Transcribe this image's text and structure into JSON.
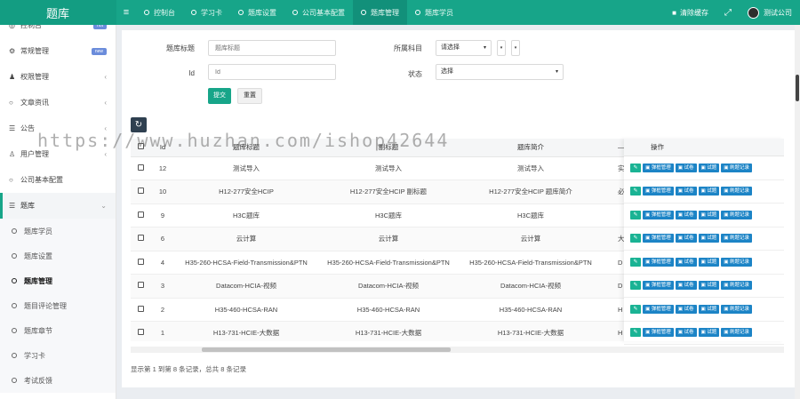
{
  "topbar": {
    "brand": "题库",
    "menu_icon": "hamburger-icon",
    "tabs": [
      {
        "label": "控制台",
        "active": false
      },
      {
        "label": "学习卡",
        "active": false
      },
      {
        "label": "题库设置",
        "active": false
      },
      {
        "label": "公司基本配置",
        "active": false
      },
      {
        "label": "题库管理",
        "active": true
      },
      {
        "label": "题库学员",
        "active": false
      }
    ],
    "clear_cache": "清除缓存",
    "fullscreen_icon": "expand-icon",
    "user": "测试公司"
  },
  "sidebar": {
    "items": [
      {
        "label": "控制台",
        "icon": "dashboard-icon",
        "badge": "hot"
      },
      {
        "label": "常规管理",
        "icon": "gears-icon",
        "badge": "new"
      },
      {
        "label": "权限管理",
        "icon": "group-icon",
        "caret": "‹"
      },
      {
        "label": "文章资讯",
        "icon": "circle-icon",
        "caret": "‹"
      },
      {
        "label": "公告",
        "icon": "list-icon",
        "caret": "‹"
      },
      {
        "label": "用户管理",
        "icon": "user-icon",
        "caret": "‹"
      },
      {
        "label": "公司基本配置",
        "icon": "circle-icon"
      },
      {
        "label": "题库",
        "icon": "list-icon",
        "caret": "⌄"
      }
    ],
    "subitems": [
      {
        "label": "题库学员",
        "active": false
      },
      {
        "label": "题库设置",
        "active": false
      },
      {
        "label": "题库管理",
        "active": true
      },
      {
        "label": "题目评论管理",
        "active": false
      },
      {
        "label": "题库章节",
        "active": false
      },
      {
        "label": "学习卡",
        "active": false
      },
      {
        "label": "考试反馈",
        "active": false
      }
    ]
  },
  "filters": {
    "title_label": "题库标题",
    "title_placeholder": "题库标题",
    "subject_label": "所属科目",
    "subject_value": "请选择",
    "id_label": "Id",
    "id_placeholder": "Id",
    "status_label": "状态",
    "status_value": "选择",
    "submit": "提交",
    "reset": "重置"
  },
  "table": {
    "headers": [
      "",
      "Id",
      "题库标题",
      "副标题",
      "题库简介",
      "..."
    ],
    "ops_header": "操作",
    "rows": [
      {
        "id": "12",
        "title": "测试导入",
        "subtitle": "测试导入",
        "intro": "测试导入",
        "extra": "实"
      },
      {
        "id": "10",
        "title": "H12-277安全HCIP",
        "subtitle": "H12-277安全HCIP 副标题",
        "intro": "H12-277安全HCIP 题库简介",
        "extra": "必"
      },
      {
        "id": "9",
        "title": "H3C题库",
        "subtitle": "H3C题库",
        "intro": "H3C题库",
        "extra": ""
      },
      {
        "id": "6",
        "title": "云计算",
        "subtitle": "云计算",
        "intro": "云计算",
        "extra": "大"
      },
      {
        "id": "4",
        "title": "H35-260-HCSA-Field-Transmission&PTN",
        "subtitle": "H35-260-HCSA-Field-Transmission&PTN",
        "intro": "H35-260-HCSA-Field-Transmission&PTN",
        "extra": "D"
      },
      {
        "id": "3",
        "title": "Datacom-HCIA-视频",
        "subtitle": "Datacom-HCIA-视频",
        "intro": "Datacom-HCIA-视频",
        "extra": "D"
      },
      {
        "id": "2",
        "title": "H35-460-HCSA-RAN",
        "subtitle": "H35-460-HCSA-RAN",
        "intro": "H35-460-HCSA-RAN",
        "extra": "H"
      },
      {
        "id": "1",
        "title": "H13-731-HCIE-大数据",
        "subtitle": "H13-731-HCIE-大数据",
        "intro": "H13-731-HCIE-大数据",
        "extra": "H"
      }
    ],
    "op_labels": [
      "弹框管理",
      "试卷",
      "试题",
      "刷题记录"
    ]
  },
  "pager": "显示第 1 到第 8 条记录，总共 8 条记录",
  "watermark": "https://www.huzhan.com/ishop42644",
  "colors": {
    "brand": "#17a589",
    "primary_btn": "#1c84c6",
    "edit_btn": "#1ab394"
  }
}
